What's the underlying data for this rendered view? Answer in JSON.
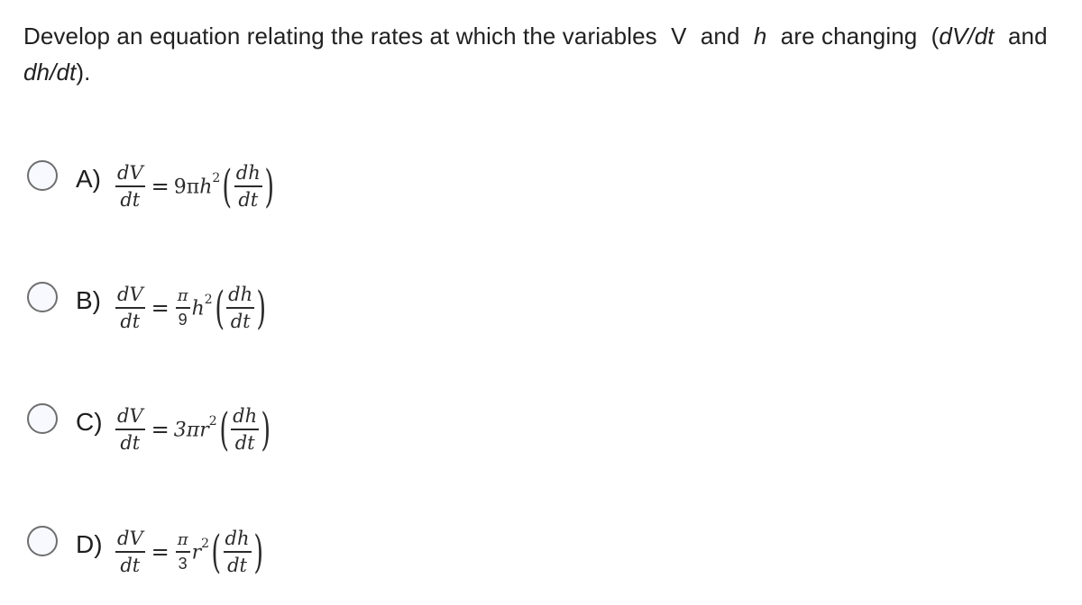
{
  "question": {
    "part1": "Develop an equation relating the rates at which the variables",
    "var_v": "V",
    "and1": "and",
    "var_h": "h",
    "part2": "are changing",
    "paren_open": "(",
    "dvdt": "dV/dt",
    "and2": "and",
    "dhdt": "dh/dt",
    "paren_close": ")."
  },
  "options": [
    {
      "label": "A)",
      "lhs_num": "dV",
      "lhs_den": "dt",
      "equals": "=",
      "coef": "9π",
      "var": "h",
      "exp": "2",
      "rhs_num": "dh",
      "rhs_den": "dt",
      "selected": false
    },
    {
      "label": "B)",
      "lhs_num": "dV",
      "lhs_den": "dt",
      "equals": "=",
      "frac_num": "π",
      "frac_den": "9",
      "var": "h",
      "exp": "2",
      "rhs_num": "dh",
      "rhs_den": "dt",
      "selected": false
    },
    {
      "label": "C)",
      "lhs_num": "dV",
      "lhs_den": "dt",
      "equals": "=",
      "coef": "3π",
      "var": "r",
      "exp": "2",
      "rhs_num": "dh",
      "rhs_den": "dt",
      "selected": false
    },
    {
      "label": "D)",
      "lhs_num": "dV",
      "lhs_den": "dt",
      "equals": "=",
      "frac_num": "π",
      "frac_den": "3",
      "var": "r",
      "exp": "2",
      "rhs_num": "dh",
      "rhs_den": "dt",
      "selected": false
    }
  ],
  "glyphs": {
    "lparen": "(",
    "rparen": ")"
  }
}
